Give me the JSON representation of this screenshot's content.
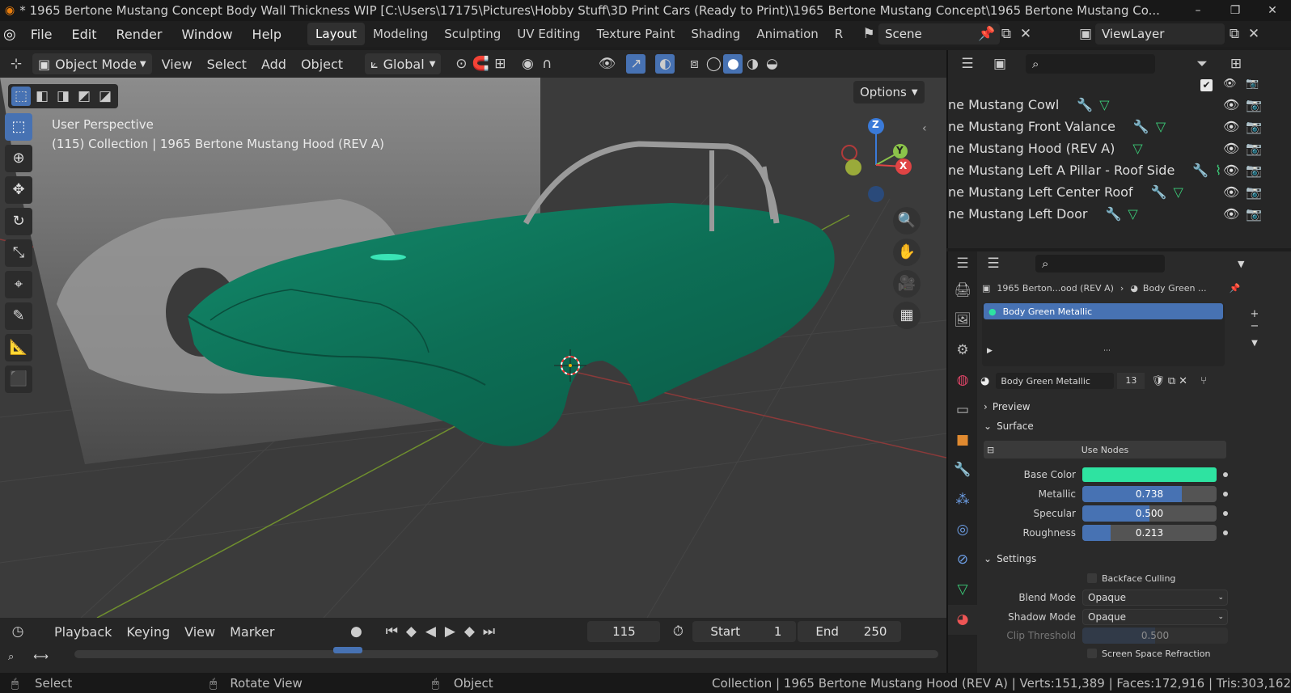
{
  "window": {
    "title": "* 1965 Bertone Mustang Concept Body Wall Thickness WIP [C:\\Users\\17175\\Pictures\\Hobby Stuff\\3D Print Cars (Ready to Print)\\1965 Bertone Mustang Concept\\1965 Bertone Mustang Co...",
    "controls": [
      "–",
      "❐",
      "✕"
    ]
  },
  "menubar": {
    "items": [
      "File",
      "Edit",
      "Render",
      "Window",
      "Help"
    ],
    "workspaces": [
      "Layout",
      "Modeling",
      "Sculpting",
      "UV Editing",
      "Texture Paint",
      "Shading",
      "Animation",
      "R"
    ],
    "active_workspace": "Layout",
    "scene": "Scene",
    "view_layer": "ViewLayer"
  },
  "viewport_header": {
    "mode": "Object Mode",
    "menus": [
      "View",
      "Select",
      "Add",
      "Object"
    ],
    "orientation": "Global",
    "options": "Options"
  },
  "viewport": {
    "perspective": "User Perspective",
    "collection_info": "(115) Collection | 1965 Bertone Mustang Hood (REV A)",
    "gizmo": {
      "z": "Z",
      "y": "Y",
      "x": "X"
    }
  },
  "outliner": {
    "rows": [
      "ne Mustang Cowl",
      "ne Mustang Front Valance",
      "ne Mustang Hood (REV A)",
      "ne Mustang Left A Pillar - Roof Side",
      "ne Mustang Left Center Roof",
      "ne Mustang Left Door"
    ]
  },
  "properties": {
    "breadcrumb_object": "1965 Berton...ood (REV A)",
    "breadcrumb_material": "Body Green ...",
    "slot_name": "Body Green Metallic",
    "material_name": "Body Green Metallic",
    "user_count": "13",
    "sections": {
      "preview": "Preview",
      "surface": "Surface",
      "settings": "Settings"
    },
    "use_nodes": "Use Nodes",
    "base_color_label": "Base Color",
    "base_color": "#2ee3a1",
    "metallic": {
      "label": "Metallic",
      "value": "0.738",
      "fraction": 0.738
    },
    "specular": {
      "label": "Specular",
      "value": "0.500",
      "fraction": 0.5
    },
    "roughness": {
      "label": "Roughness",
      "value": "0.213",
      "fraction": 0.213
    },
    "backface_culling": "Backface Culling",
    "blend_mode": {
      "label": "Blend Mode",
      "value": "Opaque"
    },
    "shadow_mode": {
      "label": "Shadow Mode",
      "value": "Opaque"
    },
    "clip_threshold": {
      "label": "Clip Threshold",
      "value": "0.500",
      "fraction": 0.5
    },
    "screen_space_refraction": "Screen Space Refraction"
  },
  "timeline": {
    "menus": [
      "Playback",
      "Keying",
      "View",
      "Marker"
    ],
    "current_frame": "115",
    "start_label": "Start",
    "start": "1",
    "end_label": "End",
    "end": "250"
  },
  "statusbar": {
    "select": "Select",
    "rotate": "Rotate View",
    "object": "Object",
    "stats": "Collection | 1965 Bertone Mustang Hood (REV A) | Verts:151,389 | Faces:172,916 | Tris:303,162"
  },
  "colors": {
    "accent": "#4772b3",
    "car_body": "#0f7a5e"
  }
}
